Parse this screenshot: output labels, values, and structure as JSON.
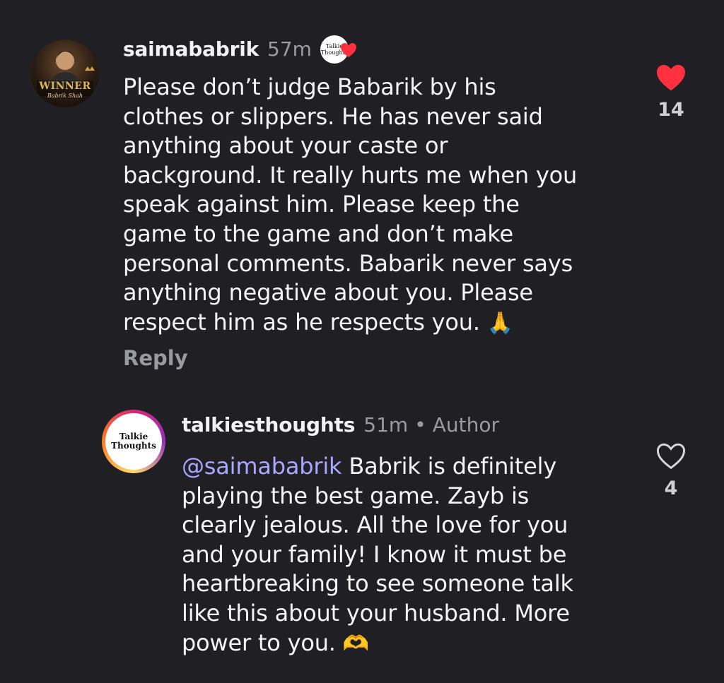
{
  "comments": [
    {
      "username": "saimababrik",
      "time": "57m",
      "avatar_text": "WINNER",
      "avatar_subtext": "Babrik Shah",
      "creator_liked_badge_text_1": "Talkie",
      "creator_liked_badge_text_2": "Thoughts",
      "text_lines": [
        "Please don’t judge Babarik by his",
        "clothes or slippers. He has never said",
        "anything about your caste or",
        "background. It really hurts me when you",
        "speak against him. Please keep the",
        "game to the game and don’t make",
        "personal comments. Babarik never says",
        "anything negative about you. Please",
        "respect him as he respects you."
      ],
      "emoji": "🙏",
      "reply_label": "Reply",
      "like_count": "14",
      "liked": true
    },
    {
      "username": "talkiesthoughts",
      "time": "51m",
      "separator": "•",
      "role": "Author",
      "avatar_text_1": "Talkie",
      "avatar_text_2": "Thoughts",
      "mention": "@saimababrik",
      "text_lines": [
        " Babrik is definitely",
        "playing the best game. Zayb is",
        "clearly jealous. All the love for you",
        "and your family! I know it must be",
        "heartbreaking to see someone talk",
        "like this about your husband. More",
        "power to you."
      ],
      "emoji": "🫶",
      "like_count": "4",
      "liked": false
    }
  ],
  "colors": {
    "background": "#1f1f24",
    "like_red": "#ff3040",
    "mention": "#a9a7ff",
    "muted": "#9a9aa2"
  },
  "icons": {
    "liked": "heart-filled-icon",
    "not_liked": "heart-outline-icon",
    "creator_badge": "creator-liked-badge-icon"
  }
}
